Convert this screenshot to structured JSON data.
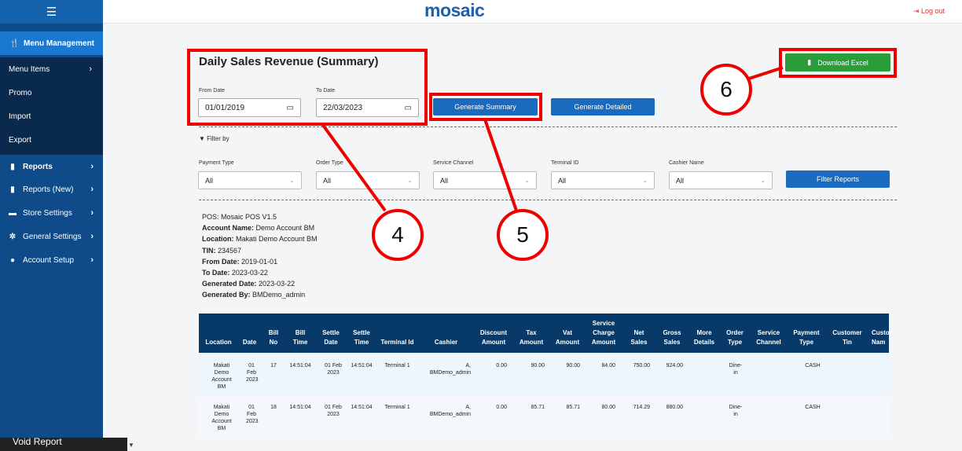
{
  "app": {
    "logo": "mosaic",
    "logout": "Log out",
    "menu_icon": "hamburger-icon"
  },
  "sidebar": {
    "menu_management": "Menu Management",
    "sub_items": [
      {
        "label": "Menu Items",
        "chevron": "›"
      },
      {
        "label": "Promo"
      },
      {
        "label": "Import"
      },
      {
        "label": "Export"
      }
    ],
    "items": [
      {
        "label": "Reports",
        "icon": "document-icon"
      },
      {
        "label": "Reports (New)",
        "icon": "document-icon"
      },
      {
        "label": "Store Settings",
        "icon": "store-icon"
      },
      {
        "label": "General Settings",
        "icon": "gear-icon"
      },
      {
        "label": "Account Setup",
        "icon": "user-icon"
      }
    ],
    "bottom_label": "Void Report"
  },
  "page": {
    "title": "Daily Sales Revenue (Summary)",
    "from_date_label": "From Date",
    "to_date_label": "To Date",
    "from_date": "01/01/2019",
    "to_date": "22/03/2023",
    "generate_summary": "Generate Summary",
    "generate_detailed": "Generate Detailed",
    "download_excel": "Download Excel",
    "filter_by": "Filter by",
    "filters": [
      {
        "label": "Payment Type",
        "value": "All"
      },
      {
        "label": "Order Type",
        "value": "All"
      },
      {
        "label": "Service Channel",
        "value": "All"
      },
      {
        "label": "Terminal ID",
        "value": "All"
      },
      {
        "label": "Cashier Name",
        "value": "All"
      }
    ],
    "filter_reports": "Filter Reports"
  },
  "info": [
    {
      "k": "POS:",
      "v": "Mosaic POS V1.5"
    },
    {
      "k": "Account Name:",
      "v": "Demo Account BM"
    },
    {
      "k": "Location:",
      "v": "Makati Demo Account BM"
    },
    {
      "k": "TIN:",
      "v": "234567"
    },
    {
      "k": "From Date:",
      "v": "2019-01-01"
    },
    {
      "k": "To Date:",
      "v": "2023-03-22"
    },
    {
      "k": "Generated Date:",
      "v": "2023-03-22"
    },
    {
      "k": "Generated By:",
      "v": "BMDemo_admin"
    }
  ],
  "table": {
    "headers": [
      "Location",
      "Date",
      "Bill No",
      "Bill Time",
      "Settle Date",
      "Settle Time",
      "Terminal Id",
      "Cashier",
      "Discount Amount",
      "Tax Amount",
      "Vat Amount",
      "Service Charge Amount",
      "Net Sales",
      "Gross Sales",
      "More Details",
      "Order Type",
      "Service Channel",
      "Payment Type",
      "Customer Tin",
      "Custo Nam"
    ],
    "rows": [
      {
        "location": "Makati Demo Account BM",
        "date": "01 Feb 2023",
        "bill_no": "17",
        "bill_time": "14:51:04",
        "settle_date": "01 Feb 2023",
        "settle_time": "14:51:04",
        "terminal": "Terminal 1",
        "cashier": "A, BMDemo_admin",
        "discount": "0.00",
        "tax": "90.00",
        "vat": "90.00",
        "service_charge": "84.00",
        "net": "750.00",
        "gross": "924.00",
        "order_type": "Dine-in",
        "payment": "CASH"
      },
      {
        "location": "Makati Demo Account BM",
        "date": "01 Feb 2023",
        "bill_no": "18",
        "bill_time": "14:51:04",
        "settle_date": "01 Feb 2023",
        "settle_time": "14:51:04",
        "terminal": "Terminal 1",
        "cashier": "A, BMDemo_admin",
        "discount": "0.00",
        "tax": "85.71",
        "vat": "85.71",
        "service_charge": "80.00",
        "net": "714.29",
        "gross": "880.00",
        "order_type": "Dine-in",
        "payment": "CASH"
      }
    ]
  },
  "callouts": [
    "4",
    "5",
    "6"
  ],
  "colors": {
    "sidebar": "#0e4b88",
    "accent": "#1a6bc0",
    "excel": "#2a9d3a",
    "annotation": "#e00000",
    "table_header": "#073a68"
  }
}
